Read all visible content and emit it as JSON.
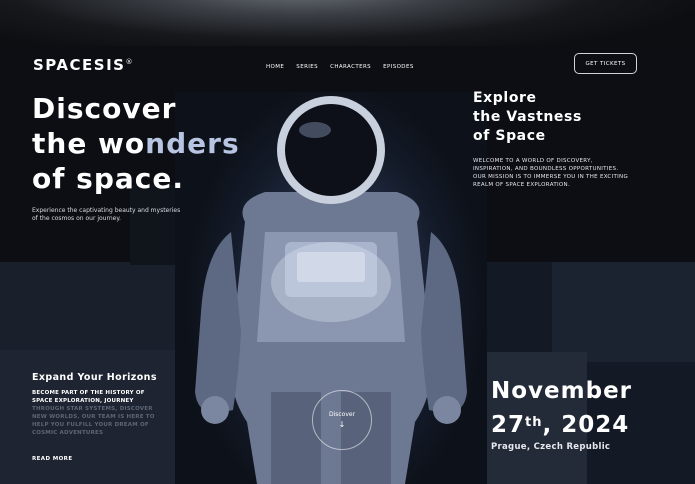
{
  "brand": {
    "name": "SPACESIS",
    "mark": "®"
  },
  "nav": {
    "items": [
      "HOME",
      "SERIES",
      "CHARACTERS",
      "EPISODES"
    ],
    "cta": "GET TICKETS"
  },
  "hero": {
    "line1": "Discover",
    "line2_a": "the wo",
    "line2_b": "nders",
    "line3": "of space.",
    "subtitle": "Experience the captivating beauty and mysteries of the cosmos on our journey."
  },
  "explore": {
    "line1": "Explore",
    "line2": "the Vastness",
    "line3": "of Space",
    "description": "WELCOME TO A WORLD OF DISCOVERY, INSPIRATION, AND BOUNDLESS OPPORTUNITIES. OUR MISSION IS TO IMMERSE YOU IN THE EXCITING REALM OF SPACE EXPLORATION."
  },
  "horizons": {
    "title": "Expand Your Horizons",
    "text_bright": "BECOME PART OF THE HISTORY OF SPACE EXPLORATION, JOURNEY",
    "text_dim": " THROUGH STAR SYSTEMS, DISCOVER NEW WORLDS. OUR TEAM IS HERE TO HELP YOU FULFILL YOUR DREAM OF COSMIC ADVENTURES",
    "read_more": "READ MORE"
  },
  "discover_button": {
    "label": "Discover",
    "arrow": "↓"
  },
  "event": {
    "month": "November",
    "day": "27",
    "suffix": "th",
    "year": ", 2024",
    "place": "Prague, Czech Republic"
  },
  "colors": {
    "accent": "#b7c5e2",
    "background": "#0c0e13",
    "muted": "#5d6676"
  }
}
